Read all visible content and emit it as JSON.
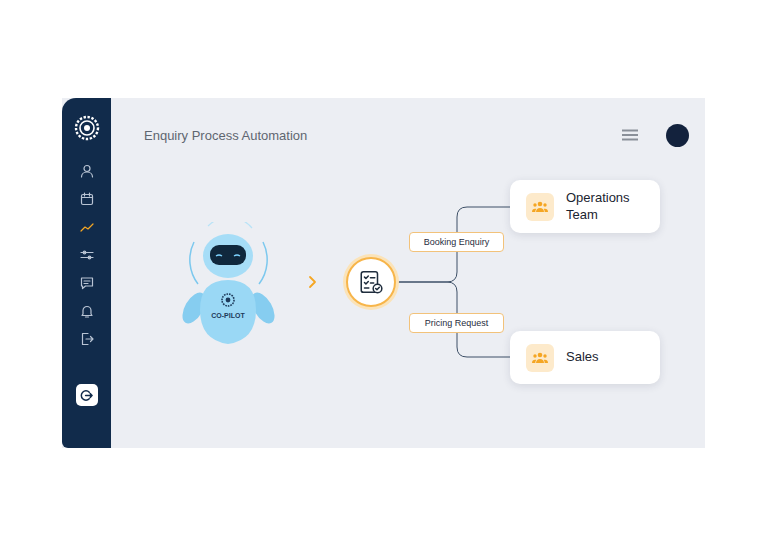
{
  "header": {
    "title": "Enquiry Process Automation"
  },
  "sidebar": {
    "items": [
      {
        "selected": false
      },
      {
        "selected": false
      },
      {
        "selected": true
      },
      {
        "selected": false
      },
      {
        "selected": false
      },
      {
        "selected": false
      },
      {
        "selected": false
      }
    ]
  },
  "assistant": {
    "badge": "CO-PILOT"
  },
  "routes": [
    {
      "label": "Booking Enquiry",
      "target": "Operations Team"
    },
    {
      "label": "Pricing Request",
      "target": "Sales"
    }
  ]
}
